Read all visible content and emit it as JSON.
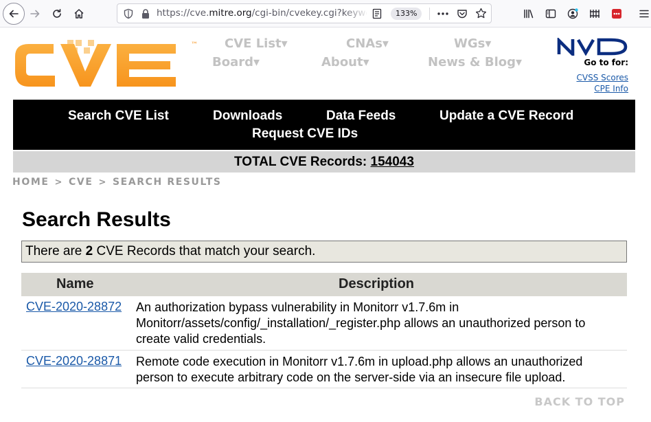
{
  "browser": {
    "url_prefix": "https://cve.",
    "url_domain": "mitre.org",
    "url_path": "/cgi-bin/cvekey.cgi?keyword",
    "zoom": "133%"
  },
  "site": {
    "logo_text": "CVE",
    "logo_tm": "™",
    "nav": [
      "CVE List▾",
      "CNAs▾",
      "WGs▾",
      "Board▾",
      "About▾",
      "News & Blog▾"
    ],
    "nvd_label": "NVD",
    "goto_label": "Go to for:",
    "side_links": [
      "CVSS Scores",
      "CPE Info"
    ]
  },
  "menu": [
    "Search CVE List",
    "Downloads",
    "Data Feeds",
    "Update a CVE Record",
    "Request CVE IDs"
  ],
  "totals": {
    "label": "TOTAL CVE Records:",
    "count": "154043"
  },
  "breadcrumb": [
    "HOME",
    "CVE",
    "SEARCH RESULTS"
  ],
  "breadcrumb_sep": ">",
  "heading": "Search Results",
  "match": {
    "prefix": "There are",
    "count": "2",
    "suffix": "CVE Records that match your search."
  },
  "table": {
    "headers": [
      "Name",
      "Description"
    ],
    "rows": [
      {
        "name": "CVE-2020-28872",
        "description": "An authorization bypass vulnerability in Monitorr v1.7.6m in Monitorr/assets/config/_installation/_register.php allows an unauthorized person to create valid credentials."
      },
      {
        "name": "CVE-2020-28871",
        "description": "Remote code execution in Monitorr v1.7.6m in upload.php allows an unauthorized person to execute arbitrary code on the server-side via an insecure file upload."
      }
    ]
  },
  "back_to_top": "BACK TO TOP",
  "colors": {
    "logo_orange": "#f7941d",
    "link_blue": "#1a59a8",
    "nav_gray": "#c2c2c2"
  }
}
